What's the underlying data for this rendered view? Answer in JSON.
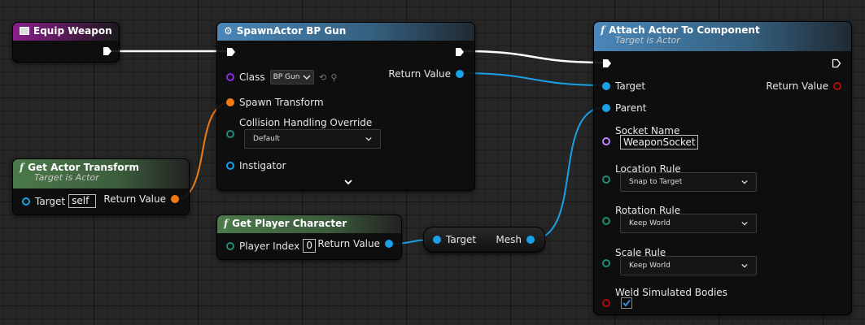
{
  "nodes": {
    "equip_weapon": {
      "title": "Equip Weapon"
    },
    "spawn_actor": {
      "title": "SpawnActor BP Gun",
      "class_label": "Class",
      "class_value": "BP Gun",
      "spawn_transform_label": "Spawn Transform",
      "collision_label": "Collision Handling Override",
      "collision_value": "Default",
      "instigator_label": "Instigator",
      "return_value_label": "Return Value"
    },
    "get_actor_transform": {
      "title": "Get Actor Transform",
      "subtitle": "Target is Actor",
      "target_label": "Target",
      "target_value": "self",
      "return_value_label": "Return Value"
    },
    "get_player_character": {
      "title": "Get Player Character",
      "player_index_label": "Player Index",
      "player_index_value": "0",
      "return_value_label": "Return Value"
    },
    "get_mesh": {
      "target_label": "Target",
      "mesh_label": "Mesh"
    },
    "attach_actor": {
      "title": "Attach Actor To Component",
      "subtitle": "Target is Actor",
      "target_label": "Target",
      "return_value_label": "Return Value",
      "parent_label": "Parent",
      "socket_name_label": "Socket Name",
      "socket_name_value": "WeaponSocket",
      "location_rule_label": "Location Rule",
      "location_rule_value": "Snap to Target",
      "rotation_rule_label": "Rotation Rule",
      "rotation_rule_value": "Keep World",
      "scale_rule_label": "Scale Rule",
      "scale_rule_value": "Keep World",
      "weld_label": "Weld Simulated Bodies",
      "weld_checked": true
    }
  },
  "colors": {
    "exec_wire": "#ffffff",
    "object_pin": "#1aa0e6",
    "transform_pin": "#f07b14",
    "enum_pin": "#1f8c74",
    "class_pin": "#8a2be2",
    "name_pin": "#c080ff",
    "bool_pin": "#b00a0a",
    "event_header": "#8a1e8a",
    "pure_header": "#4b7a4b",
    "function_header": "#4a86b8"
  },
  "icons": [
    "event-icon",
    "spawn-icon",
    "function-icon",
    "exec-pin-icon",
    "chevron-down-icon",
    "checkmark-icon",
    "reset-arrow-icon",
    "browse-search-icon"
  ]
}
